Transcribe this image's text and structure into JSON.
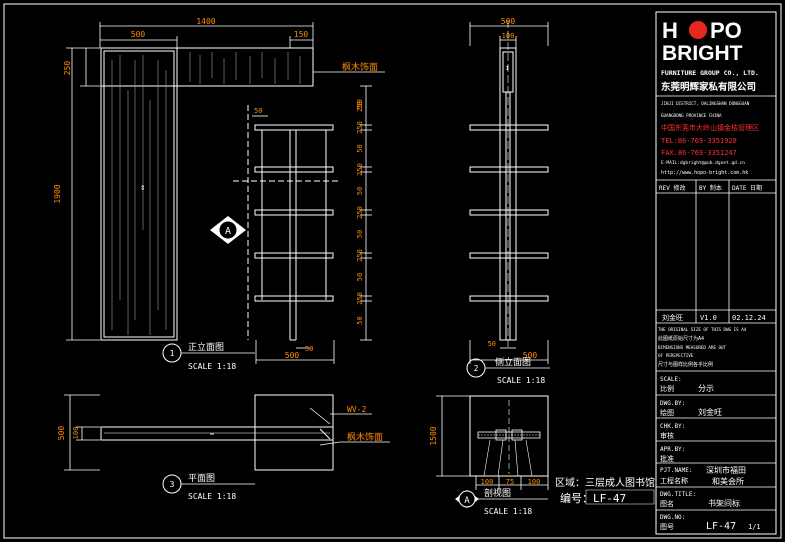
{
  "front_view": {
    "dims": {
      "overall_width": "1400",
      "left_width": "500",
      "right_width": "150",
      "top_height": "250",
      "total_height": "1900",
      "shelf_left_gap": "50",
      "bottom_width": "500",
      "bottom_small": "50"
    },
    "right_dims": [
      "250",
      "50",
      "250",
      "50",
      "250",
      "50",
      "250",
      "50",
      "250",
      "50",
      "250",
      "50",
      "250"
    ],
    "note_wood": "枫木饰面",
    "section_marker": "A",
    "title_number": "1",
    "title_cn": "正立面图",
    "title_scale": "SCALE 1:18"
  },
  "side_view": {
    "dims": {
      "top_width": "500",
      "top_small": "100",
      "bottom_small": "50",
      "bottom_width": "500"
    },
    "title_number": "2",
    "title_cn": "侧立面图",
    "title_scale": "SCALE 1:18"
  },
  "plan_view": {
    "dims": {
      "left_vertical_1": "500",
      "left_vertical_2": "100"
    },
    "note_wv": "WV-2",
    "note_wood": "枫木饰面",
    "title_number": "3",
    "title_cn": "平面图",
    "title_scale": "SCALE 1:18"
  },
  "section_view": {
    "dims": {
      "left": "1500",
      "bottom_1": "100",
      "bottom_2": "75",
      "bottom_3": "100"
    },
    "title_letter": "A",
    "title_cn": "剖视图",
    "title_scale": "SCALE 1:18"
  },
  "area_note": "区域：三层成人图书馆",
  "drawing_code_note": "编号：LF-47",
  "title_block": {
    "logo_line1_a": "H",
    "logo_line1_b": "PO",
    "logo_line2": "BRIGHT",
    "company_en": "FURNITURE GROUP CO., LTD.",
    "company_cn": "东莞明辉家私有限公司",
    "address_en_1": "JINJI DISTRICT, DALINGSHAN DONGGUAN",
    "address_en_2": "GUANGDONG PROVINCE CHINA",
    "address_cn": "中国东莞市大岭山镇金桔管理区",
    "tel": "TEL:86-769-3351928",
    "fax": "FAX:86-769-3351247",
    "email": "E-MAIL:dgbright@pub.dgnet.gd.cn",
    "web": "http://www.hopo-bright.com.hk",
    "rev_header": [
      "REV 修改",
      "BY 制本",
      "DATE 日期"
    ],
    "rev_row": [
      "刘金旺",
      "V1.0",
      "02.12.24"
    ],
    "note_en_1": "THE ORIGINAL SIZE OF THIS DWG IS A4",
    "note_cn_1": "此图纸原始尺寸为A4",
    "note_en_2": "DIMENSIONS MEASURED ARE OUT",
    "note_en_3": "OF PERSPECTIVE",
    "note_cn_2": "尺寸与图样比例各乎比例",
    "scale_label_en": "SCALE:",
    "scale_label_cn": "比例",
    "scale_value": "分示",
    "drawn_label_en": "DWG.BY:",
    "drawn_label_cn": "绘图",
    "drawn_value": "刘金旺",
    "chk_label_en": "CHK.BY:",
    "chk_label_cn": "审核",
    "apr_label_en": "APR.BY:",
    "apr_label_cn": "批准",
    "pjt_label_en": "PJT.NAME:",
    "pjt_label_cn": "工程名称",
    "pjt_value_1": "深圳市福田",
    "pjt_value_2": "和美会所",
    "title_label_en": "DWG.TITLE:",
    "title_label_cn": "图名",
    "title_value": "书架间标",
    "no_label_en": "DWG.NO:",
    "no_label_cn": "图号",
    "no_value": "LF-47",
    "sheet_value": "1/1"
  }
}
